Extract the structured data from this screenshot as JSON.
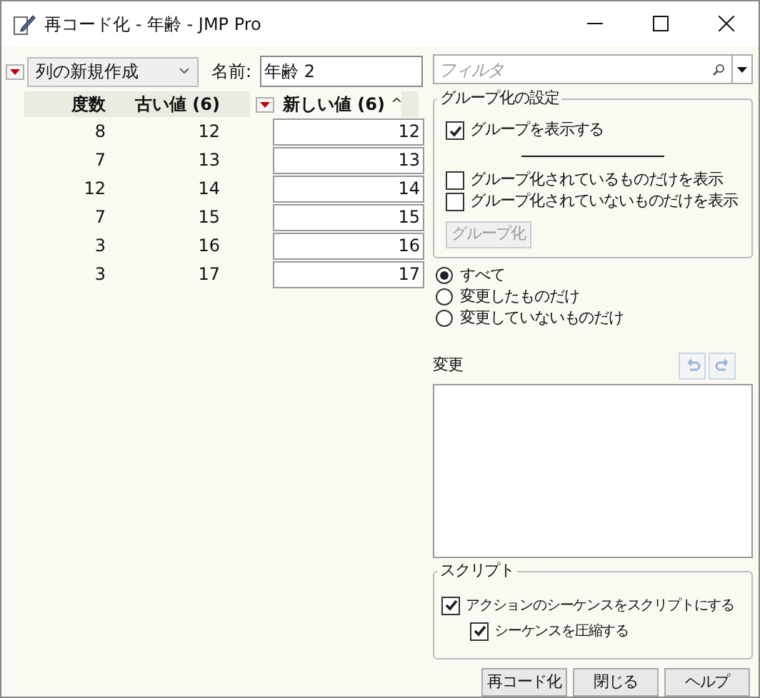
{
  "window": {
    "title": "再コード化 - 年齢 - JMP Pro"
  },
  "toolbar": {
    "dropdown": "列の新規作成",
    "name_label": "名前:",
    "name_value": "年齢 2"
  },
  "table": {
    "columns": [
      "度数",
      "古い値 (6)",
      "新しい値 (6)"
    ],
    "sort_mark": "^",
    "rows": [
      {
        "count": "8",
        "old": "12",
        "new": "12"
      },
      {
        "count": "7",
        "old": "13",
        "new": "13"
      },
      {
        "count": "12",
        "old": "14",
        "new": "14"
      },
      {
        "count": "7",
        "old": "15",
        "new": "15"
      },
      {
        "count": "3",
        "old": "16",
        "new": "16"
      },
      {
        "count": "3",
        "old": "17",
        "new": "17"
      }
    ]
  },
  "filter": {
    "placeholder": "フィルタ"
  },
  "group_settings": {
    "title": "グループ化の設定",
    "options": [
      {
        "label": "グループを表示する",
        "checked": true,
        "indent": false
      },
      {
        "label": "グループ化されているものだけを表示",
        "checked": false,
        "indent": false
      },
      {
        "label": "グループ化されていないものだけを表示",
        "checked": false,
        "indent": false
      }
    ],
    "button": {
      "label": "グループ化",
      "disabled": true
    }
  },
  "view_options": [
    {
      "label": "すべて",
      "selected": true
    },
    {
      "label": "変更したものだけ",
      "selected": false
    },
    {
      "label": "変更していないものだけ",
      "selected": false
    }
  ],
  "changes": {
    "label": "変更",
    "undo_disabled": true,
    "redo_disabled": true
  },
  "script": {
    "title": "スクリプト",
    "options": [
      {
        "label": "アクションのシーケンスをスクリプトにする",
        "checked": true,
        "indent": false
      },
      {
        "label": "シーケンスを圧縮する",
        "checked": true,
        "indent": true
      }
    ]
  },
  "buttons": [
    "再コード化",
    "閉じる",
    "ヘルプ"
  ]
}
